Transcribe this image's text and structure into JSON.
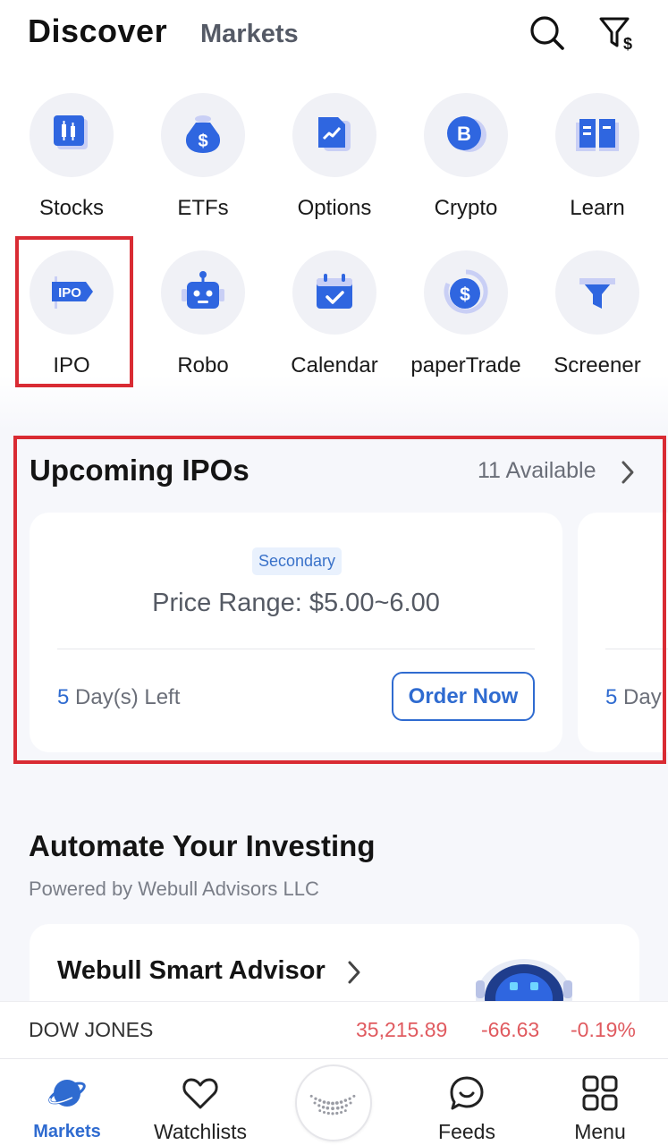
{
  "header": {
    "tabs": [
      {
        "label": "Discover",
        "active": true
      },
      {
        "label": "Markets",
        "active": false
      }
    ],
    "icons": [
      "search-icon",
      "filter-dollar-icon"
    ]
  },
  "categories": [
    {
      "label": "Stocks",
      "icon": "stocks-icon"
    },
    {
      "label": "ETFs",
      "icon": "money-bag-icon"
    },
    {
      "label": "Options",
      "icon": "options-chart-icon"
    },
    {
      "label": "Crypto",
      "icon": "bitcoin-icon"
    },
    {
      "label": "Learn",
      "icon": "book-icon"
    },
    {
      "label": "IPO",
      "icon": "ipo-tag-icon"
    },
    {
      "label": "Robo",
      "icon": "robot-icon"
    },
    {
      "label": "Calendar",
      "icon": "calendar-icon"
    },
    {
      "label": "paperTrade",
      "icon": "paper-trade-icon"
    },
    {
      "label": "Screener",
      "icon": "funnel-icon"
    }
  ],
  "ipo_section": {
    "title": "Upcoming IPOs",
    "available": "11 Available",
    "card": {
      "badge": "Secondary",
      "price_range": "Price Range: $5.00~6.00",
      "days_num": "5",
      "days_text": " Day(s) Left",
      "button": "Order Now"
    },
    "next_card": {
      "days_num": "5",
      "days_text": " Day"
    }
  },
  "automate_section": {
    "title": "Automate Your Investing",
    "subtitle": "Powered by Webull Advisors LLC",
    "card_title": "Webull Smart Advisor"
  },
  "ticker": {
    "name": "DOW JONES",
    "value": "35,215.89",
    "change": "-66.63",
    "change_pct": "-0.19%"
  },
  "bottom_nav": [
    {
      "label": "Markets",
      "icon": "planet-icon",
      "active": true
    },
    {
      "label": "Watchlists",
      "icon": "heart-icon",
      "active": false
    },
    {
      "label": "",
      "icon": "webull-logo-icon",
      "active": false
    },
    {
      "label": "Feeds",
      "icon": "chat-bubble-icon",
      "active": false
    },
    {
      "label": "Menu",
      "icon": "grid-icon",
      "active": false
    }
  ],
  "colors": {
    "accent": "#2f6bd0",
    "icon_blue": "#2f66e0",
    "icon_light": "#c9cff5",
    "highlight": "#d92b33",
    "negative": "#e05a5f"
  }
}
